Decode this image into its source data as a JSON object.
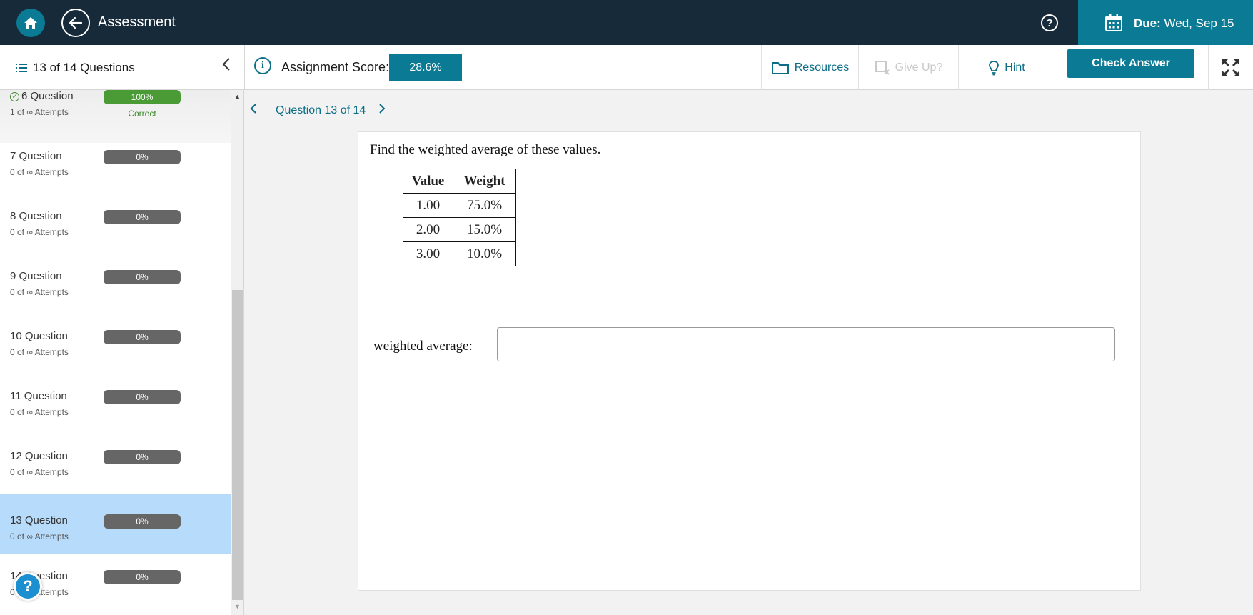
{
  "topbar": {
    "title": "Assessment",
    "due_label": "Due:",
    "due_value": "Wed, Sep 15",
    "help_glyph": "?"
  },
  "subbar": {
    "question_count": "13 of 14 Questions",
    "score_label": "Assignment Score:",
    "score_value": "28.6%",
    "resources": "Resources",
    "give_up": "Give Up?",
    "hint": "Hint",
    "check_answer": "Check Answer"
  },
  "sidebar": {
    "items": [
      {
        "name": "6 Question",
        "attempts": "1 of ∞ Attempts",
        "progress": "100%",
        "status": "Correct"
      },
      {
        "name": "7 Question",
        "attempts": "0 of ∞ Attempts",
        "progress": "0%"
      },
      {
        "name": "8 Question",
        "attempts": "0 of ∞ Attempts",
        "progress": "0%"
      },
      {
        "name": "9 Question",
        "attempts": "0 of ∞ Attempts",
        "progress": "0%"
      },
      {
        "name": "10 Question",
        "attempts": "0 of ∞ Attempts",
        "progress": "0%"
      },
      {
        "name": "11 Question",
        "attempts": "0 of ∞ Attempts",
        "progress": "0%"
      },
      {
        "name": "12 Question",
        "attempts": "0 of ∞ Attempts",
        "progress": "0%"
      },
      {
        "name": "13 Question",
        "attempts": "0 of ∞ Attempts",
        "progress": "0%"
      },
      {
        "name": "14 Question",
        "attempts": "0 of ∞ Attempts",
        "progress": "0%"
      }
    ],
    "help_fab": "?"
  },
  "main": {
    "question_nav": "Question 13 of 14",
    "prompt": "Find the weighted average of these values.",
    "table": {
      "headers": [
        "Value",
        "Weight"
      ],
      "rows": [
        [
          "1.00",
          "75.0%"
        ],
        [
          "2.00",
          "15.0%"
        ],
        [
          "3.00",
          "10.0%"
        ]
      ]
    },
    "answer_label": "weighted average:",
    "answer_value": ""
  },
  "colors": {
    "topbar": "#172a3a",
    "accent": "#0b7a94",
    "active_row": "#b7dcfb",
    "correct": "#4a9a36"
  },
  "icons": [
    "home-icon",
    "back-arrow-icon",
    "help-icon",
    "calendar-icon",
    "list-icon",
    "chevron-left-icon",
    "info-icon",
    "folder-icon",
    "give-up-icon",
    "lightbulb-icon",
    "expand-icon",
    "check-circle-icon"
  ]
}
